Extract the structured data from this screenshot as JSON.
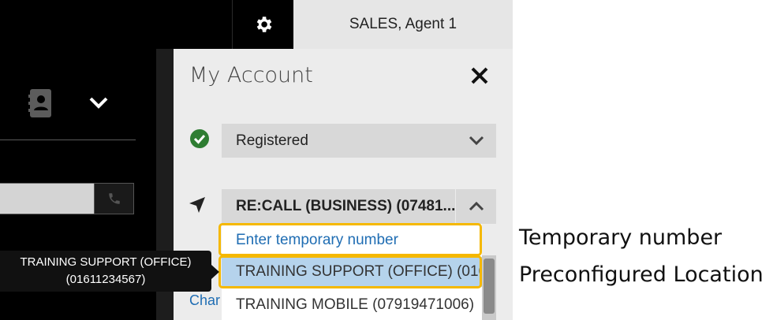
{
  "header": {
    "agent_name": "SALES, Agent 1",
    "settings_icon": "gear-icon"
  },
  "left_app": {
    "contacts_icon": "address-book-icon",
    "expand_icon": "chevron-down-icon",
    "call_icon": "phone-icon"
  },
  "tooltip": {
    "line1": "TRAINING SUPPORT (OFFICE)",
    "line2": "(01611234567)"
  },
  "account": {
    "title": "My Account",
    "close_icon": "close-icon",
    "status": {
      "icon": "check-circle-icon",
      "value": "Registered",
      "chevron": "chevron-down-icon"
    },
    "location": {
      "icon": "navigation-arrow-icon",
      "value": "RE:CALL (BUSINESS) (07481...",
      "toggle_icon": "chevron-up-icon",
      "options": [
        "Enter temporary number",
        "TRAINING SUPPORT (OFFICE) (0161",
        "TRAINING MOBILE (07919471006)"
      ]
    },
    "change_link": "Char"
  },
  "annotations": {
    "temporary": "Temporary number",
    "preconfigured": "Preconfigured Location"
  },
  "colors": {
    "highlight": "#f5b800",
    "link": "#1f6db3",
    "selected_option": "#b5d3ec",
    "status_ok": "#2e7d32"
  }
}
